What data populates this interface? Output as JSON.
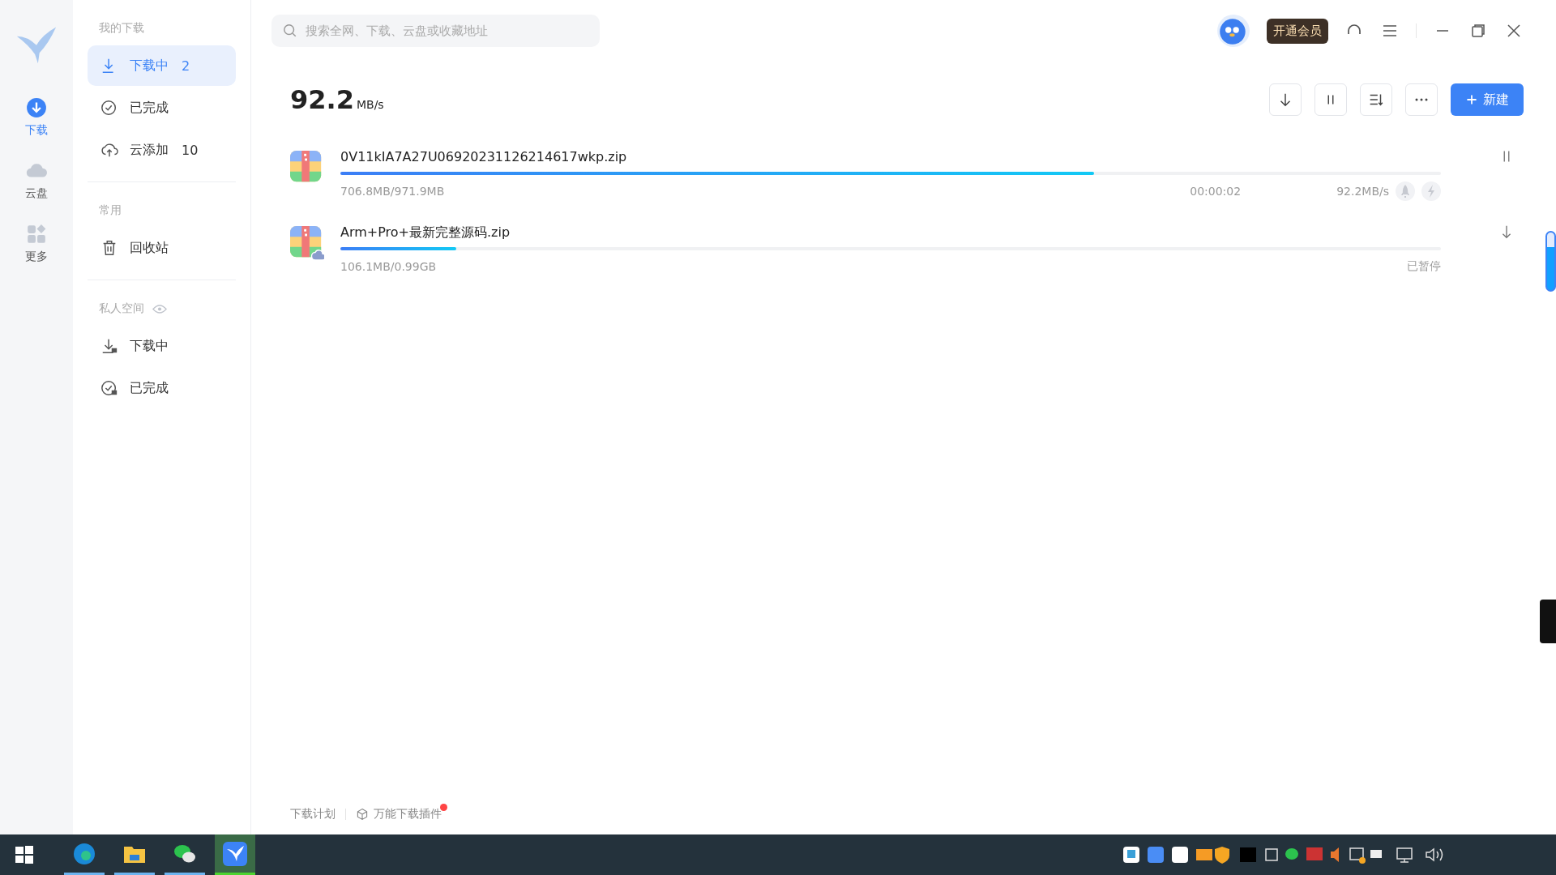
{
  "nav": [
    {
      "kind": "download",
      "label": "下载",
      "selected": true
    },
    {
      "kind": "cloud",
      "label": "云盘",
      "selected": false
    },
    {
      "kind": "more",
      "label": "更多",
      "selected": false
    }
  ],
  "sidebar": {
    "sections": [
      {
        "title": "我的下载",
        "items": [
          {
            "kind": "download",
            "label": "下载中",
            "count": "2",
            "selected": true
          },
          {
            "kind": "done",
            "label": "已完成",
            "selected": false
          },
          {
            "kind": "cloud-add",
            "label": "云添加",
            "count": "10",
            "selected": false
          }
        ]
      },
      {
        "title": "常用",
        "items": [
          {
            "kind": "trash",
            "label": "回收站",
            "selected": false
          }
        ]
      },
      {
        "title": "私人空间",
        "eye": true,
        "items": [
          {
            "kind": "lock-download",
            "label": "下载中",
            "selected": false
          },
          {
            "kind": "lock-done",
            "label": "已完成",
            "selected": false
          }
        ]
      }
    ]
  },
  "search": {
    "placeholder": "搜索全网、下载、云盘或收藏地址"
  },
  "vip_button": "开通会员",
  "speed": {
    "value": "92.2",
    "unit": "MB/s"
  },
  "new_button": "新建",
  "downloads": [
    {
      "kind": "downloading",
      "name": "0V11kIA7A27U06920231126214617wkp.zip",
      "size": "706.8MB/971.9MB",
      "time": "00:00:02",
      "rate": "92.2MB/s",
      "level": 0.685,
      "cloud": false
    },
    {
      "kind": "paused",
      "name": "Arm+Pro+最新完整源码.zip",
      "size": "106.1MB/0.99GB",
      "status": "已暂停",
      "level": 0.105,
      "cloud": true
    }
  ],
  "footer": {
    "plan": "下载计划",
    "plugin": "万能下载插件",
    "plugin_dot": true
  },
  "taskbar": {
    "apps": [
      {
        "kind": "edge",
        "selected": false
      },
      {
        "kind": "folder",
        "selected": false
      },
      {
        "kind": "chat",
        "selected": false
      },
      {
        "kind": "bird",
        "selected": true
      }
    ]
  }
}
